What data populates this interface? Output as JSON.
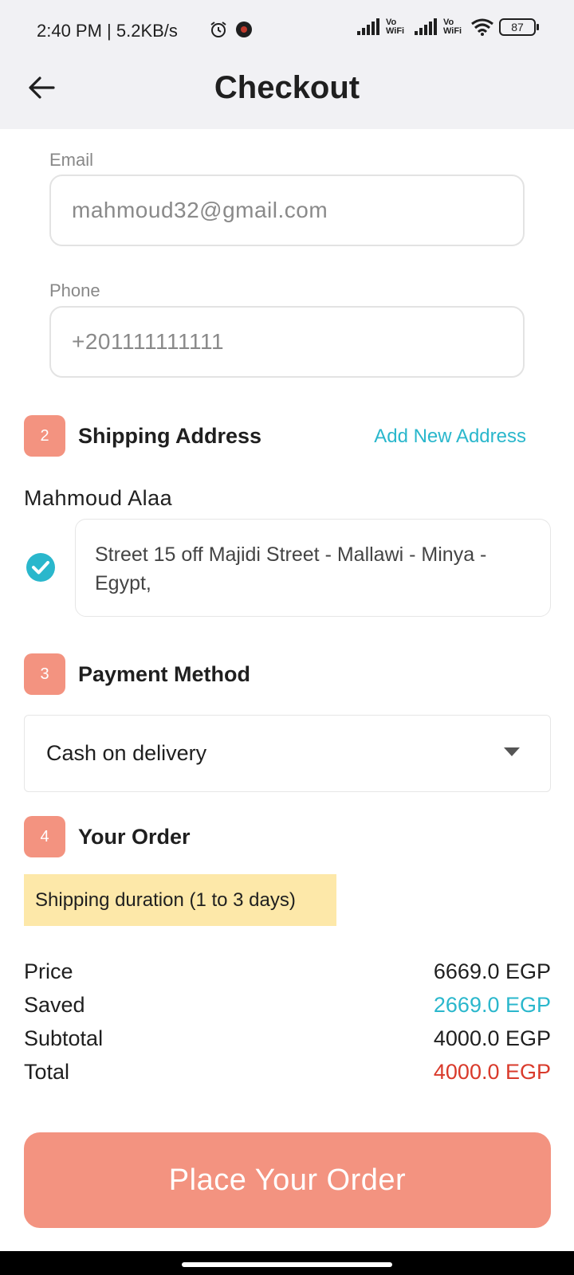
{
  "status_bar": {
    "time": "2:40 PM | 5.2KB/s",
    "vowifi_1": "Vo WiFi",
    "vowifi_2": "Vo WiFi",
    "battery": "87"
  },
  "header": {
    "title": "Checkout"
  },
  "contact": {
    "email_label": "Email",
    "email_value": "mahmoud32@gmail.com",
    "phone_label": "Phone",
    "phone_value": "+201111111111"
  },
  "shipping": {
    "step": "2",
    "title": "Shipping Address",
    "add_new": "Add New Address",
    "recipient": "Mahmoud Alaa",
    "address": "Street 15 off Majidi Street - Mallawi - Minya - Egypt,"
  },
  "payment": {
    "step": "3",
    "title": "Payment Method",
    "selected": "Cash on delivery"
  },
  "order": {
    "step": "4",
    "title": "Your Order",
    "shipping_note": "Shipping duration (1 to 3 days)",
    "price_label": "Price",
    "price_value": "6669.0 EGP",
    "saved_label": "Saved",
    "saved_value": "2669.0 EGP",
    "subtotal_label": "Subtotal",
    "subtotal_value": "4000.0 EGP",
    "total_label": "Total",
    "total_value": "4000.0 EGP"
  },
  "actions": {
    "place_order": "Place Your Order"
  },
  "colors": {
    "accent": "#f39380",
    "link": "#2ab7cc",
    "saved": "#2ab7cc",
    "total": "#d93a2b",
    "note_bg": "#fde8a9"
  }
}
